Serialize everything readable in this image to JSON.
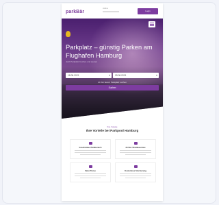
{
  "header": {
    "logo": "parkBär",
    "hotline_label": "Hotline",
    "button_label": "Login"
  },
  "hero": {
    "title": "Parkplatz – günstig Parken am Flughafen Hamburg",
    "subtitle": "Jetzt Parkplatz buchen und sparen",
    "arrival_value": "18.06.2021",
    "departure_value": "25.06.2021",
    "check_label": "Ich bin bereit. Parkplatz suchen",
    "search_label": "Suchen"
  },
  "section": {
    "eyebrow": "Ihre Vorteile",
    "title": "Ihre Vorteile bei Parkpool Hamburg"
  },
  "features": [
    {
      "title": "Geschützter Parkbereich",
      "icon": "shield-icon"
    },
    {
      "title": "24 Std. Shuttleservice",
      "icon": "shuttle-icon"
    },
    {
      "title": "Faire Preise",
      "icon": "euro-icon"
    },
    {
      "title": "Kostenlose Stornierung",
      "icon": "calendar-icon"
    }
  ],
  "colors": {
    "brand": "#7d3ca0",
    "background": "#f1f3f9"
  }
}
